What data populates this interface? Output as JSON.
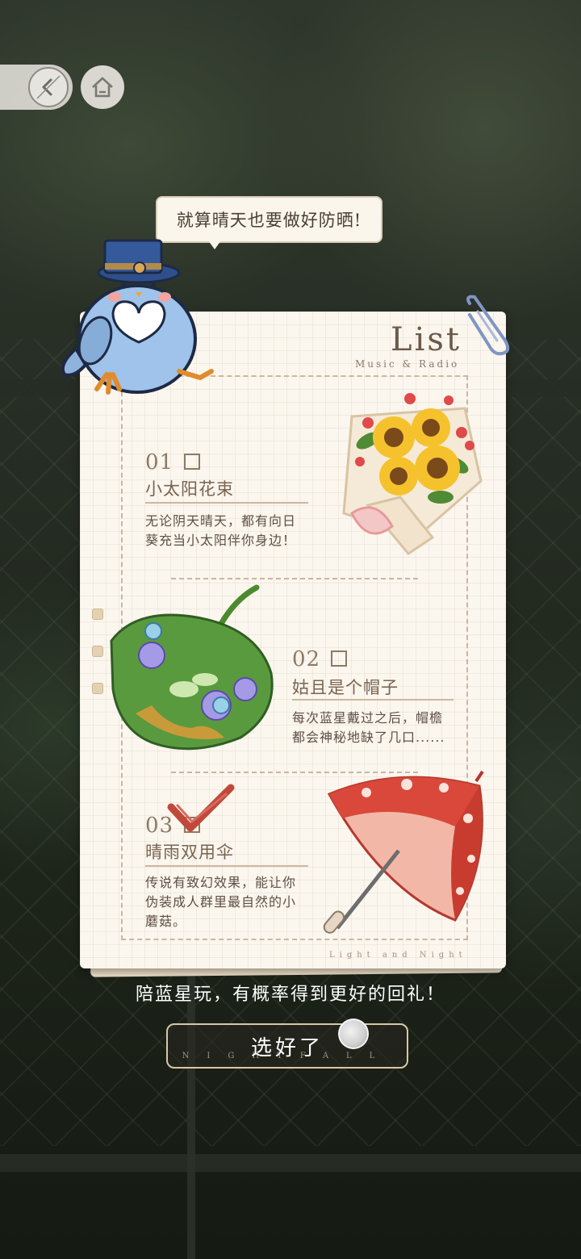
{
  "nav": {
    "back_icon": "back-arrow-icon",
    "home_icon": "home-icon"
  },
  "bubble": {
    "text": "就算晴天也要做好防晒!"
  },
  "card": {
    "title": "List",
    "subtitle": "Music & Radio",
    "footer": "Light and Night"
  },
  "items": [
    {
      "number": "01",
      "name": "小太阳花束",
      "desc_line1": "无论阴天晴天，都有向日",
      "desc_line2": "葵充当小太阳伴你身边！",
      "checked": false,
      "image": "sunflower-bouquet"
    },
    {
      "number": "02",
      "name": "姑且是个帽子",
      "desc_line1": "每次蓝星戴过之后，帽檐",
      "desc_line2": "都会神秘地缺了几口......",
      "checked": false,
      "image": "leaf-hat"
    },
    {
      "number": "03",
      "name": "晴雨双用伞",
      "desc_line1": "传说有致幻效果，能让你",
      "desc_line2": "伪装成人群里最自然的小",
      "desc_line3": "蘑菇。",
      "checked": true,
      "image": "mushroom-umbrella"
    }
  ],
  "hint": "陪蓝星玩，有概率得到更好的回礼！",
  "confirm": {
    "label": "选好了",
    "sub": "NIGHTFALL"
  },
  "colors": {
    "accent": "#c0493b",
    "paper": "#fbf6ee",
    "text": "#7a6450"
  }
}
